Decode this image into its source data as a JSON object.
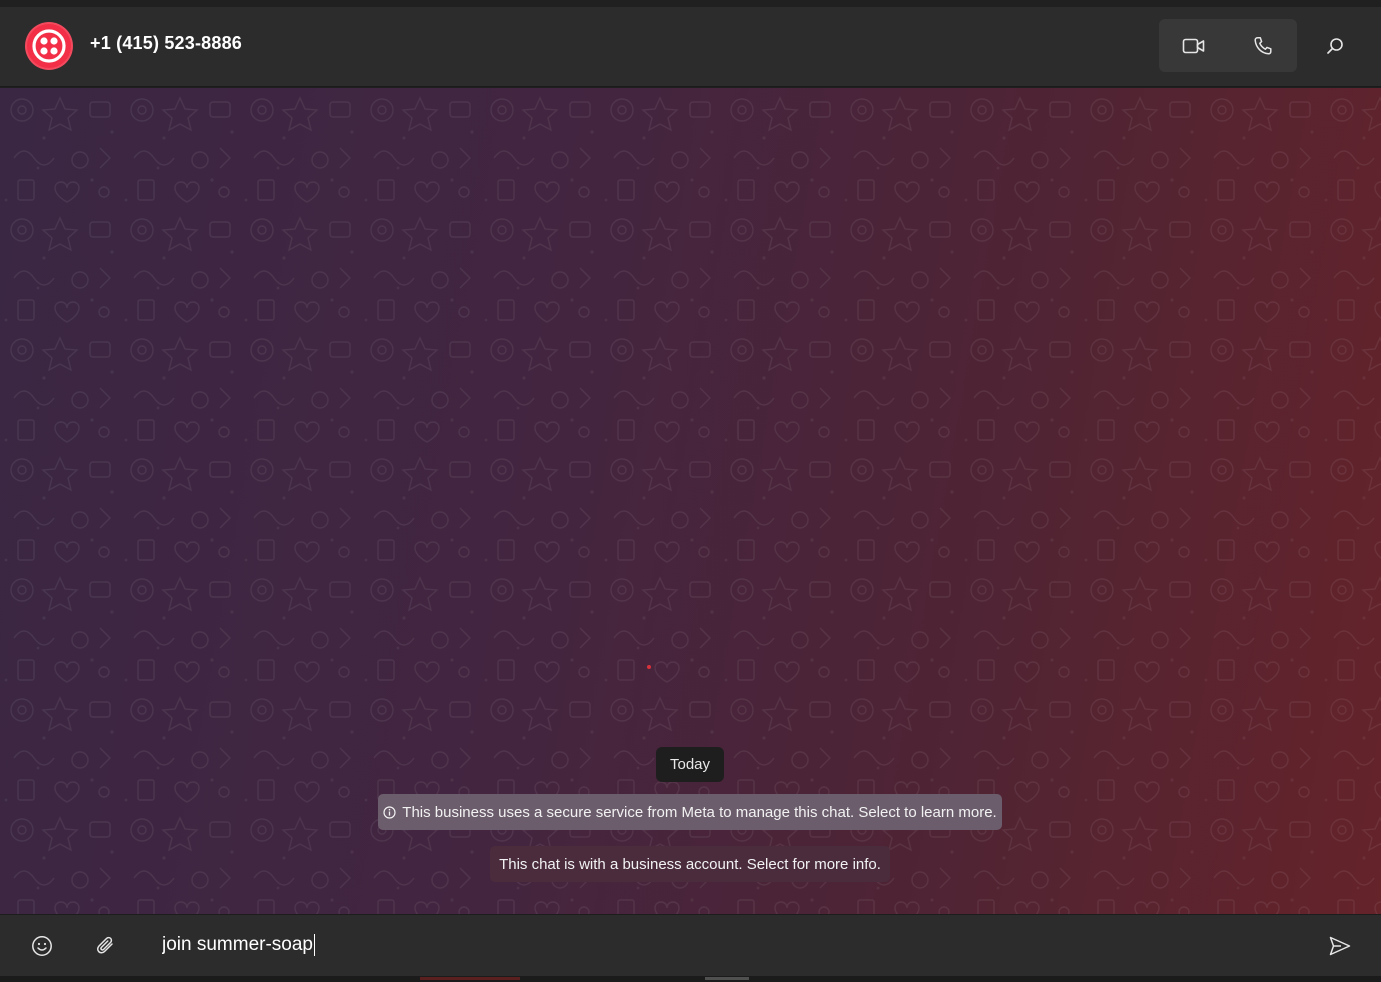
{
  "header": {
    "contact_name": "+1 (415) 523-8886",
    "avatar_icon": "twilio-logo-icon",
    "avatar_color": "#f22f46",
    "video_icon": "video-call-icon",
    "phone_icon": "phone-icon",
    "search_icon": "search-icon"
  },
  "chat": {
    "date_label": "Today",
    "meta_notice": "This business uses a secure service from Meta to manage this chat. Select to learn more.",
    "business_notice": "This chat is with a business account. Select for more info."
  },
  "composer": {
    "emoji_icon": "emoji-icon",
    "attach_icon": "paperclip-icon",
    "message_value": "join summer-soap",
    "send_icon": "send-icon"
  }
}
